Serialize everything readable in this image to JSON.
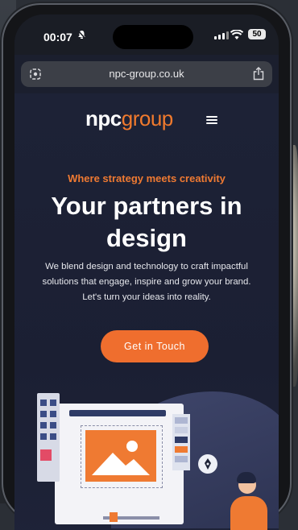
{
  "status_bar": {
    "time": "00:07",
    "battery": "50"
  },
  "browser": {
    "url": "npc-group.co.uk"
  },
  "site": {
    "logo_npc": "npc",
    "logo_group": "group",
    "tagline": "Where strategy meets creativity",
    "headline_line1": "Your partners in",
    "headline_line2": "design",
    "description": "We blend design and technology to craft impactful solutions that engage, inspire and grow your brand. Let's turn your ideas into reality.",
    "cta_label": "Get in Touch"
  },
  "colors": {
    "accent": "#ef6e2e",
    "page_background": "#1d2236"
  },
  "icons": [
    "bell-slash-icon",
    "signal-icon",
    "wifi-icon",
    "battery-icon",
    "tab-icon",
    "share-icon",
    "menu-icon",
    "pen-icon"
  ]
}
